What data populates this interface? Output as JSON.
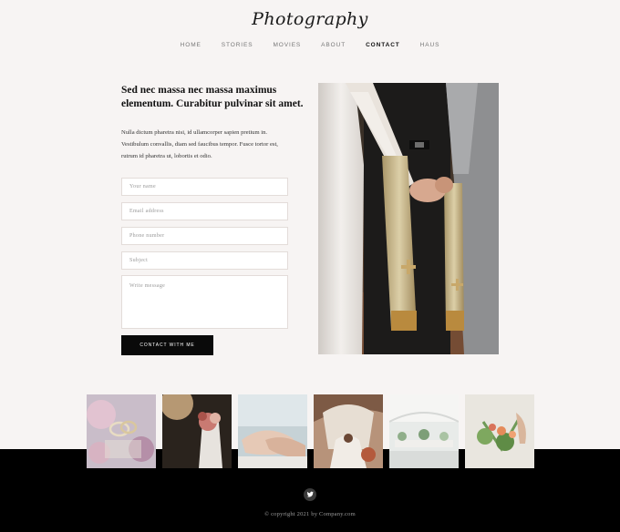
{
  "brand": {
    "logo_text": "Photography"
  },
  "nav": {
    "items": [
      "HOME",
      "STORIES",
      "MOVIES",
      "ABOUT",
      "CONTACT",
      "HAUS"
    ],
    "active": "CONTACT"
  },
  "contact": {
    "heading": "Sed nec massa nec massa maximus elementum. Curabitur pulvinar sit amet.",
    "paragraph": "Nulla dictum pharetra nisi, id ullamcorper sapien pretium in. Vestibulum convallis, diam sed faucibus tempor. Fusce tortor est, rutrum id pharetra ut, lobortis et odio.",
    "fields": {
      "name_placeholder": "Your name",
      "email_placeholder": "Email address",
      "phone_placeholder": "Phone number",
      "subject_placeholder": "Subject",
      "message_placeholder": "Write message"
    },
    "submit_label": "CONTACT WITH ME"
  },
  "footer": {
    "copyright": "© copyright 2021 by Company.com",
    "social_icon": "twitter-icon"
  },
  "colors": {
    "page_bg": "#f7f4f3",
    "footer_bg": "#000000",
    "button_bg": "#0a0a0a",
    "text_dark": "#111111"
  }
}
